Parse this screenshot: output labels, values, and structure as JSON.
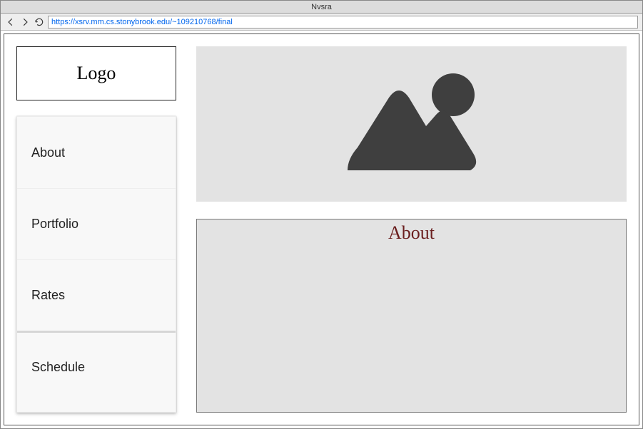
{
  "window": {
    "title": "Nvsra"
  },
  "url": "https://xsrv.mm.cs.stonybrook.edu/~109210768/final",
  "logo": {
    "text": "Logo"
  },
  "nav": {
    "items": [
      {
        "label": "About"
      },
      {
        "label": "Portfolio"
      },
      {
        "label": "Rates"
      },
      {
        "label": "Schedule"
      }
    ]
  },
  "about": {
    "heading": "About"
  },
  "icons": {
    "back": "back-arrow",
    "forward": "forward-arrow",
    "reload": "reload-circle",
    "hero": "image-placeholder"
  }
}
